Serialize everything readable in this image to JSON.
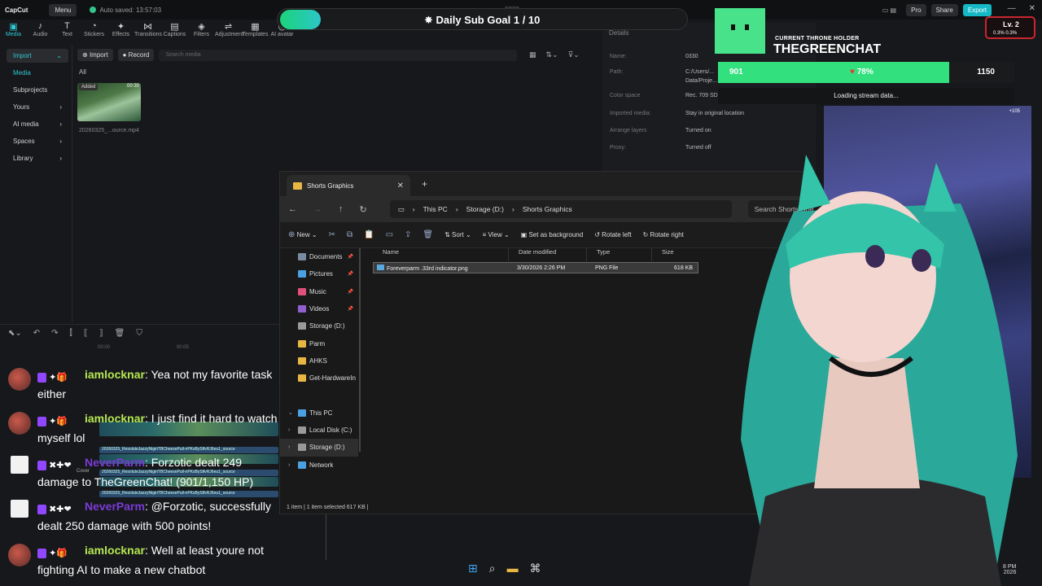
{
  "capcut": {
    "logo": "CapCut",
    "menu": "Menu",
    "autosave": "Auto saved: 13:57:03",
    "project_title": "0330",
    "right_buttons": [
      "Pro",
      "Share",
      "Export"
    ],
    "tools": [
      {
        "icon": "▣",
        "label": "Media"
      },
      {
        "icon": "♪",
        "label": "Audio"
      },
      {
        "icon": "T",
        "label": "Text"
      },
      {
        "icon": "◔",
        "label": "Stickers"
      },
      {
        "icon": "✦",
        "label": "Effects"
      },
      {
        "icon": "⋈",
        "label": "Transitions"
      },
      {
        "icon": "▤",
        "label": "Captions"
      },
      {
        "icon": "◈",
        "label": "Filters"
      },
      {
        "icon": "⇌",
        "label": "Adjustment"
      },
      {
        "icon": "▦",
        "label": "Templates"
      },
      {
        "icon": "◎",
        "label": "AI avatar"
      }
    ],
    "sidebar": [
      {
        "label": "Import",
        "chev": "⌄"
      },
      {
        "label": "Media",
        "chev": ""
      },
      {
        "label": "Subprojects",
        "chev": ""
      },
      {
        "label": "Yours",
        "chev": "›"
      },
      {
        "label": "AI media",
        "chev": "›"
      },
      {
        "label": "Spaces",
        "chev": "›"
      },
      {
        "label": "Library",
        "chev": "›"
      }
    ],
    "import_btn": "Import",
    "record_btn": "Record",
    "search_placeholder": "Search media",
    "all_label": "All",
    "clip": {
      "tag": "Added",
      "duration": "00:30",
      "name": "20260325_...ource.mp4"
    },
    "details": {
      "heading": "Details",
      "rows": [
        {
          "k": "Name:",
          "v": "0330"
        },
        {
          "k": "Path:",
          "v": "C:/Users/..."
        },
        {
          "k": "",
          "v": "Data/Proje..."
        },
        {
          "k": "Color space",
          "v": "Rec. 709 SD..."
        },
        {
          "k": "Imported media:",
          "v": "Stay in original location"
        },
        {
          "k": "Arrange layers",
          "v": "Turned on"
        },
        {
          "k": "Proxy:",
          "v": "Turned off"
        }
      ]
    },
    "timeline": {
      "ruler": [
        "00:00",
        "00:05"
      ],
      "tracks": [
        "20260325_ResoluteJazzyNigiriTBCheesePull-nPKsBySlfvRJ6eu1_source",
        "20260325_ResoluteJazzyNigiriTBCheesePull-nPKsBySlfvRJ6eu1_source",
        "20260325_ResoluteJazzyNigiriTBCheesePull-nPKsBySlfvRJ6eu1_source"
      ],
      "cover": "Cover"
    }
  },
  "explorer": {
    "tab_title": "Shorts Graphics",
    "breadcrumbs": [
      "This PC",
      "Storage (D:)",
      "Shorts Graphics"
    ],
    "search_placeholder": "Search Shorts Graphics",
    "commands": [
      "New",
      "Sort",
      "View",
      "Set as background",
      "Rotate left",
      "Rotate right"
    ],
    "nav": [
      {
        "label": "Documents",
        "pin": true,
        "color": "#7a8aa0"
      },
      {
        "label": "Pictures",
        "pin": true,
        "color": "#4aa0e0"
      },
      {
        "label": "Music",
        "pin": true,
        "color": "#e0507a"
      },
      {
        "label": "Videos",
        "pin": true,
        "color": "#9060d0"
      },
      {
        "label": "Storage (D:)",
        "pin": false,
        "color": "#999999"
      },
      {
        "label": "Parm",
        "pin": false,
        "color": "#e8b642"
      },
      {
        "label": "AHKS",
        "pin": false,
        "color": "#e8b642"
      },
      {
        "label": "Get-HardwareIn",
        "pin": false,
        "color": "#e8b642"
      },
      {
        "label": "",
        "pin": false,
        "color": ""
      },
      {
        "label": "This PC",
        "pin": false,
        "color": "#4aa0e0"
      },
      {
        "label": "Local Disk (C:)",
        "pin": false,
        "color": "#999999"
      },
      {
        "label": "Storage (D:)",
        "pin": false,
        "color": "#999999"
      },
      {
        "label": "Network",
        "pin": false,
        "color": "#4aa0e0"
      }
    ],
    "columns": [
      "Name",
      "Date modified",
      "Type",
      "Size"
    ],
    "files": [
      {
        "name": "Foreverparm .33rd indicator.png",
        "date": "3/30/2026 2:26 PM",
        "type": "PNG File",
        "size": "618 KB"
      }
    ],
    "status": "1 item  |  1 item selected  617 KB  |"
  },
  "overlay": {
    "subgoal": "Daily Sub Goal  1 / 10",
    "subgoal_progress": 0.1,
    "throne_label": "CURRENT THRONE HOLDER",
    "throne_name": "THEGREENCHAT",
    "hp_left": "901",
    "hp_pct": "78%",
    "hp_right": "1150",
    "hp_fraction": 0.78,
    "loading": "Loading stream data...",
    "level": "Lv. 2",
    "level_sub": "0.3%  0.3%",
    "cam_badge": "+105",
    "hp_color": "#33e07e"
  },
  "chat": [
    {
      "user": "iamlocknar",
      "color": "#b5e853",
      "l1": ": Yea not my favorite task",
      "l2": "either",
      "badges": "✦🎁"
    },
    {
      "user": "iamlocknar",
      "color": "#b5e853",
      "l1": ": I just find it hard to watch",
      "l2": "myself lol",
      "badges": "✦🎁"
    },
    {
      "user": "NeverParm",
      "color": "#7a3bd6",
      "l1": ": Forzotic dealt 249",
      "l2": "damage to TheGreenChat! (901/1,150 HP)",
      "badges": "✖✚❤"
    },
    {
      "user": "NeverParm",
      "color": "#7a3bd6",
      "l1": ": @Forzotic, successfully",
      "l2": "dealt 250 damage with 500 points!",
      "badges": "✖✚❤"
    },
    {
      "user": "iamlocknar",
      "color": "#b5e853",
      "l1": ": Well at least youre not",
      "l2": "fighting AI to make a new chatbot",
      "badges": "✦🎁"
    }
  ],
  "taskbar": {
    "clock_time": "8 PM",
    "clock_date": "2026"
  }
}
